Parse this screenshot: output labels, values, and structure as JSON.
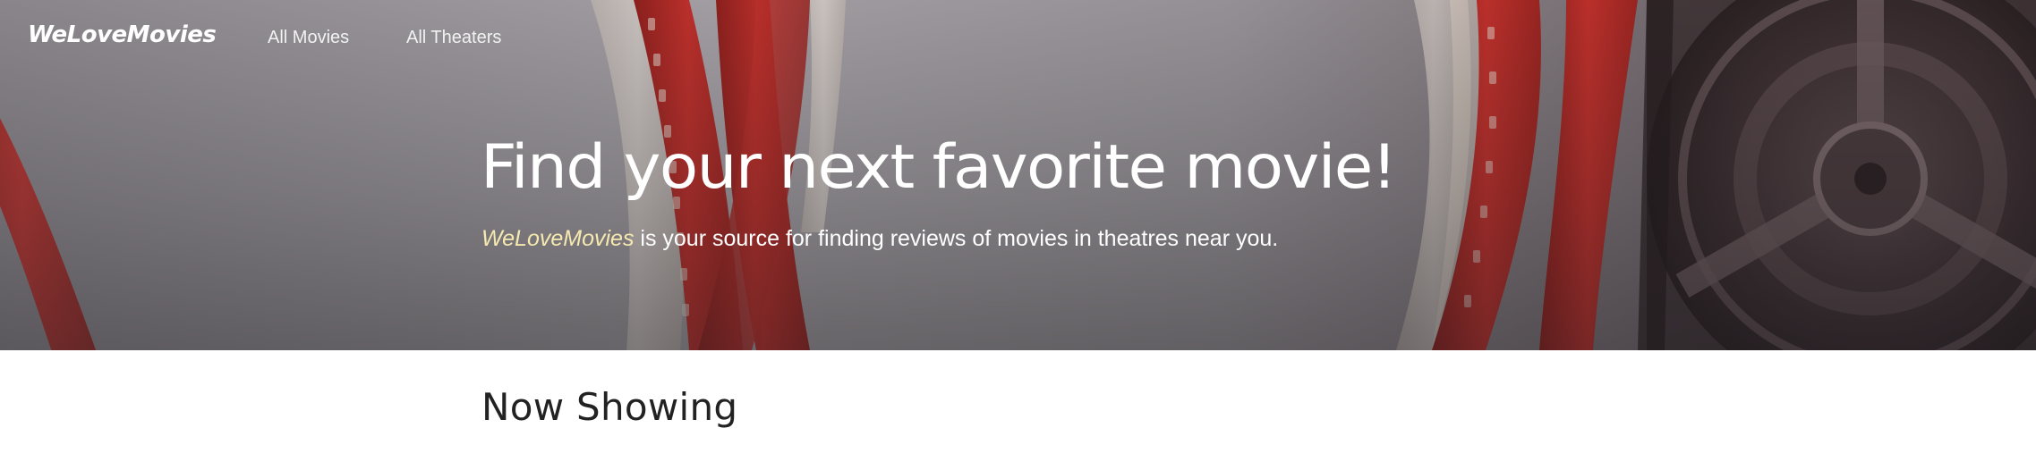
{
  "navbar": {
    "brand": "WeLoveMovies",
    "links": [
      {
        "label": "All Movies"
      },
      {
        "label": "All Theaters"
      }
    ]
  },
  "hero": {
    "title": "Find your next favorite movie!",
    "lead_brand": "WeLoveMovies",
    "lead_text": " is your source for finding reviews of movies in theatres near you.",
    "accent_color": "#f5e9b0",
    "background_image": "film-reel-with-red-film-strips"
  },
  "main": {
    "section_title": "Now Showing"
  }
}
